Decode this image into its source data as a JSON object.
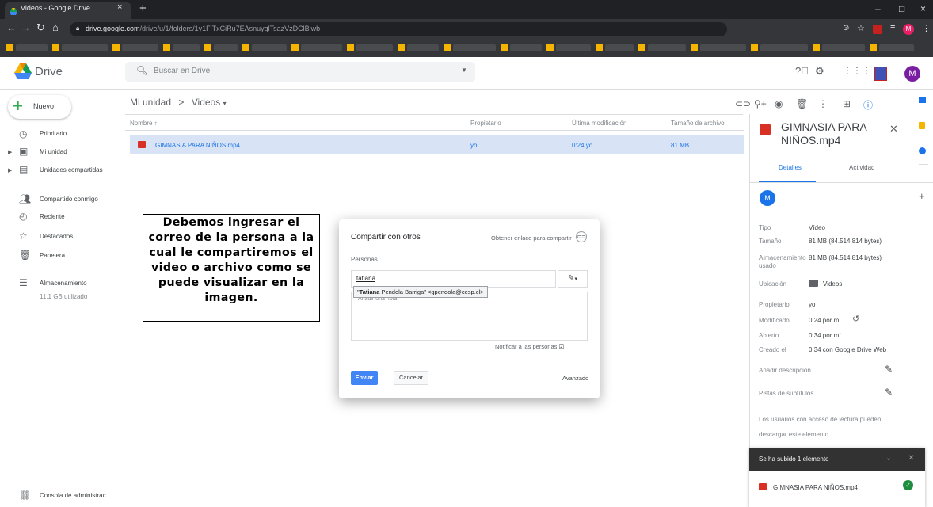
{
  "browser": {
    "tab_title": "Videos - Google Drive",
    "tab_close": "×",
    "tab_new": "+",
    "url_host": "drive.google.com",
    "url_path": "/drive/u/1/folders/1y1FiTxCiRu7EAsnuyglTsazVzDClBiwb",
    "window_controls": [
      "–",
      "□",
      "×"
    ]
  },
  "drive": {
    "app_name": "Drive",
    "search_placeholder": "Buscar en Drive",
    "avatar_letter": "M"
  },
  "sidebar": {
    "new_label": "Nuevo",
    "items": [
      {
        "label": "Prioritario",
        "icon": "clock-check-icon"
      },
      {
        "label": "Mi unidad",
        "icon": "my-drive-icon"
      },
      {
        "label": "Unidades compartidas",
        "icon": "shared-drives-icon"
      },
      {
        "label": "Compartido conmigo",
        "icon": "people-icon"
      },
      {
        "label": "Reciente",
        "icon": "clock-icon"
      },
      {
        "label": "Destacados",
        "icon": "star-icon"
      },
      {
        "label": "Papelera",
        "icon": "trash-icon"
      },
      {
        "label": "Almacenamiento",
        "icon": "storage-icon"
      }
    ],
    "storage_used": "11,1 GB utilizado",
    "admin_console": "Consola de administrac..."
  },
  "breadcrumb": {
    "root": "Mi unidad",
    "separator": ">",
    "current": "Videos"
  },
  "file_list": {
    "columns": [
      "Nombre ↑",
      "Propietario",
      "Última modificación",
      "Tamaño de archivo"
    ],
    "rows": [
      {
        "name": "GIMNASIA PARA NIÑOS.mp4",
        "owner": "yo",
        "modified": "0:24 yo",
        "size": "81 MB"
      }
    ]
  },
  "details_panel": {
    "title": "GIMNASIA PARA NIÑOS.mp4",
    "tabs": [
      "Detalles",
      "Actividad"
    ],
    "avatar_letter": "M",
    "properties": [
      {
        "key": "Tipo",
        "value": "Vídeo"
      },
      {
        "key": "Tamaño",
        "value": "81 MB (84.514.814 bytes)"
      },
      {
        "key": "Almacenamiento usado",
        "value": "81 MB (84.514.814 bytes)"
      },
      {
        "key": "Ubicación",
        "value": "Videos"
      },
      {
        "key": "Propietario",
        "value": "yo"
      },
      {
        "key": "Modificado",
        "value": "0:24 por mí"
      },
      {
        "key": "Abierto",
        "value": "0:34 por mí"
      },
      {
        "key": "Creado el",
        "value": "0:34 con Google Drive Web"
      }
    ],
    "add_description": "Añadir descripción",
    "subtitles": "Pistas de subtítulos",
    "access_note_1": "Los usuarios con acceso de lectura pueden",
    "access_note_2": "descargar este elemento"
  },
  "upload_toast": {
    "title": "Se ha subido 1 elemento",
    "file": "GIMNASIA PARA NIÑOS.mp4"
  },
  "callout": {
    "text": "Debemos ingresar el correo de la persona a la cual le compartiremos el video o archivo como se puede visualizar en la imagen."
  },
  "share_dialog": {
    "title": "Compartir con otros",
    "get_link": "Obtener enlace para compartir",
    "people_label": "Personas",
    "input_value": "tatiana",
    "suggestion_bold": "Tatiana",
    "suggestion_rest": " Pendola Barriga\" <gpendola@cesp.cl>",
    "suggestion_prefix": "\"",
    "note_placeholder": "Añadir una nota",
    "notify": "Notificar a las personas",
    "send": "Enviar",
    "cancel": "Cancelar",
    "advanced": "Avanzado"
  }
}
